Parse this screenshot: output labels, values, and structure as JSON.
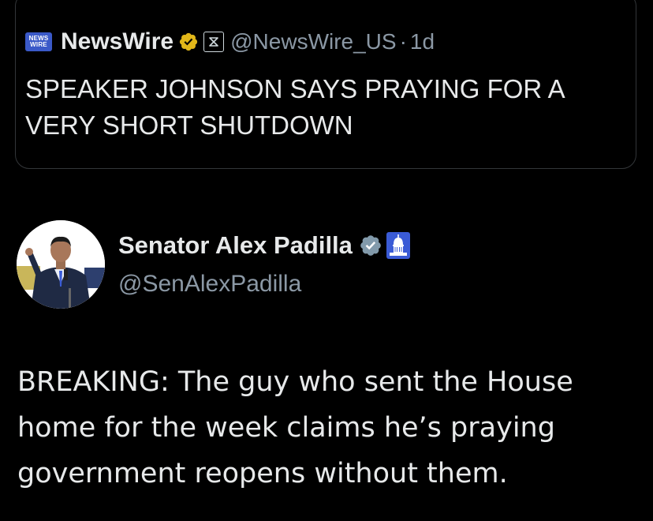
{
  "quoted_tweet": {
    "logo_line1": "NEWS",
    "logo_line2": "WIRE",
    "name": "NewsWire",
    "handle": "@NewsWire_US",
    "separator": "·",
    "time": "1d",
    "text": "SPEAKER JOHNSON SAYS PRAYING FOR A VERY SHORT SHUTDOWN",
    "verified_badge": "gold-verified-badge-icon",
    "affiliate_icon": "affiliate-square-icon"
  },
  "tweet": {
    "author_name": "Senator Alex Padilla",
    "author_handle": "@SenAlexPadilla",
    "verified_badge": "gray-verified-badge-icon",
    "affiliate_icon": "capitol-icon",
    "text": "BREAKING: The guy who sent the House home for the week claims he’s praying government reopens without them."
  },
  "colors": {
    "background": "#000000",
    "primary_text": "#e7e9ea",
    "secondary_text": "#8b98a5",
    "card_border": "#333639",
    "gold_badge": "#e2b719",
    "gray_badge": "#829aab",
    "capitol_badge": "#3a5bd6"
  }
}
